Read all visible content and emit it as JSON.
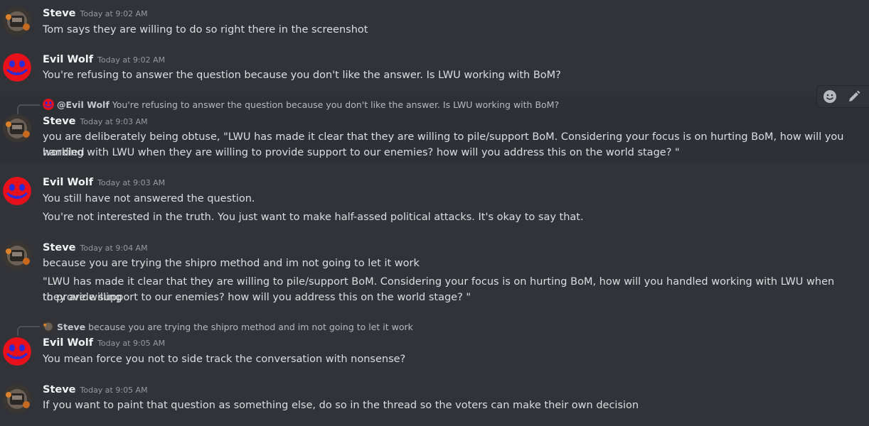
{
  "messages": [
    {
      "author": "Steve",
      "timestamp": "Today at 9:02 AM",
      "lines": [
        "Tom says they are willing to do so right there in the screenshot"
      ]
    },
    {
      "author": "Evil Wolf",
      "timestamp": "Today at 9:02 AM",
      "lines": [
        "You're refusing to answer the question because you don't like the answer. Is LWU working with BoM?"
      ]
    },
    {
      "author": "Steve",
      "timestamp": "Today at 9:03 AM",
      "reply": {
        "name": "@Evil Wolf",
        "text": "You're refusing to answer the question because you don't like the answer. Is LWU working with BoM?"
      },
      "lines": [
        "you are deliberately being obtuse, \"LWU has made it clear that they are willing to pile/support BoM. Considering your focus is on hurting BoM, how will you handled",
        "working with LWU when they are willing to provide support to our enemies? how will you address this on the world stage? \""
      ]
    },
    {
      "author": "Evil Wolf",
      "timestamp": "Today at 9:03 AM",
      "lines": [
        "You still have not answered the question.",
        "You're not interested in the truth. You just want to make half-assed political attacks. It's okay to say that."
      ]
    },
    {
      "author": "Steve",
      "timestamp": "Today at 9:04 AM",
      "lines": [
        "because you are trying the shipro method and im not going to let it work",
        "\"LWU has made it clear that they are willing to pile/support BoM. Considering your focus is on hurting BoM, how will you handled working with LWU when they are willing",
        "to provide support to our enemies? how will you address this on the world stage? \""
      ]
    },
    {
      "author": "Evil Wolf",
      "timestamp": "Today at 9:05 AM",
      "reply": {
        "name": "Steve",
        "text": "because you are trying the shipro method and im not going to let it work"
      },
      "lines": [
        "You mean force you not to side track the conversation with nonsense?"
      ]
    },
    {
      "author": "Steve",
      "timestamp": "Today at 9:05 AM",
      "lines": [
        "If you want to paint that question as something else, do so in the thread so the voters can make their own decision"
      ]
    }
  ],
  "icons": {
    "reaction": "smiley-icon",
    "edit": "pencil-icon"
  },
  "colors": {
    "background": "#313338",
    "hover": "#2e3035",
    "wolf_avatar": "#e8101a"
  }
}
